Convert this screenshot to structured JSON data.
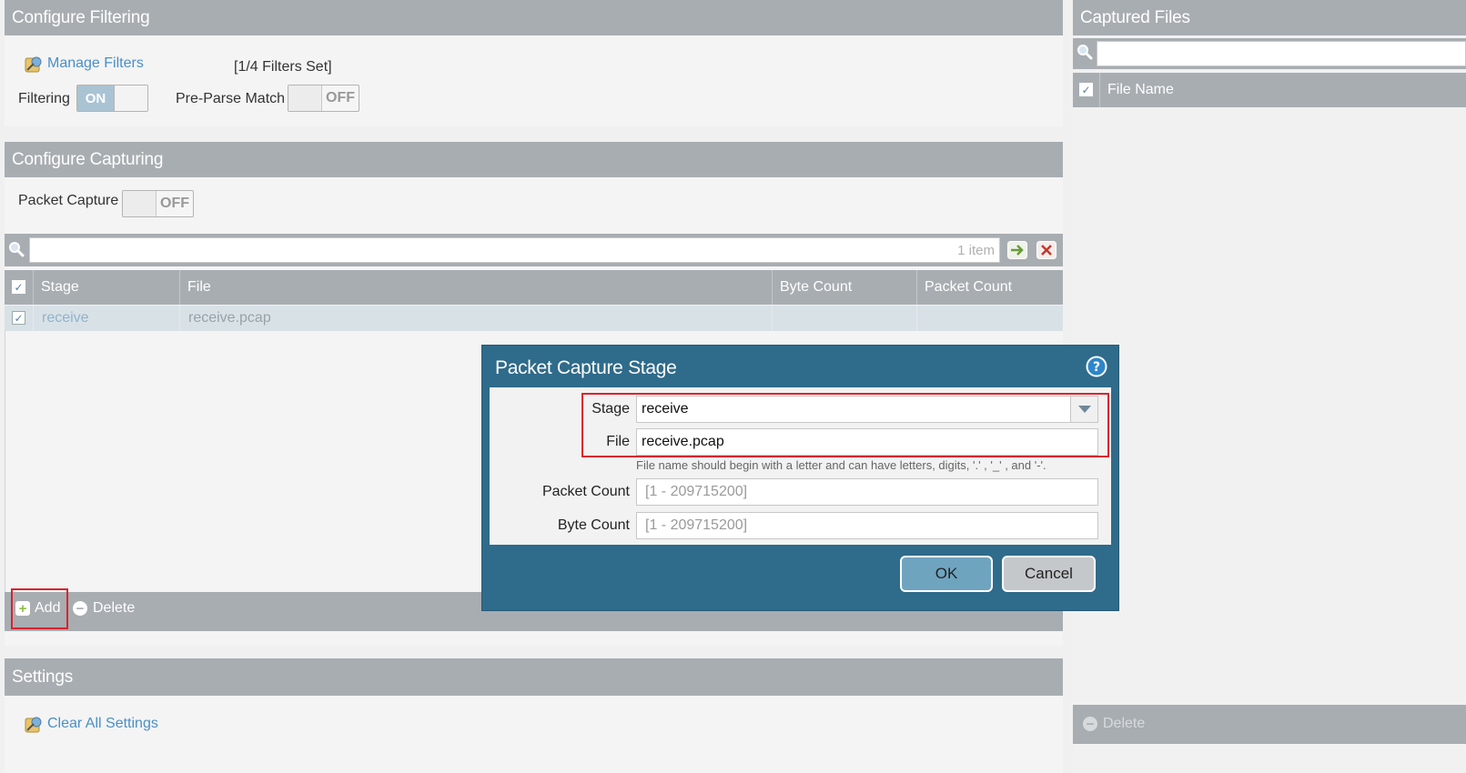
{
  "filtering": {
    "header": "Configure Filtering",
    "manage_filters": "Manage Filters",
    "filters_set": "[1/4 Filters Set]",
    "filtering_label": "Filtering",
    "filtering_state": "ON",
    "preparse_label": "Pre-Parse Match",
    "preparse_state": "OFF"
  },
  "capturing": {
    "header": "Configure Capturing",
    "packet_capture_label": "Packet Capture",
    "packet_capture_state": "OFF",
    "item_count": "1 item",
    "columns": [
      "Stage",
      "File",
      "Byte Count",
      "Packet Count"
    ],
    "rows": [
      {
        "stage": "receive",
        "file": "receive.pcap",
        "byte_count": "",
        "packet_count": ""
      }
    ],
    "add_label": "Add",
    "delete_label": "Delete"
  },
  "settings": {
    "header": "Settings",
    "clear_all": "Clear All Settings"
  },
  "captured_files": {
    "header": "Captured Files",
    "column": "File Name",
    "delete_label": "Delete"
  },
  "dialog": {
    "title": "Packet Capture Stage",
    "stage_label": "Stage",
    "stage_value": "receive",
    "file_label": "File",
    "file_value": "receive.pcap",
    "hint": "File name should begin with a letter and can have letters, digits, '.' , '_' , and '-'.",
    "packet_count_label": "Packet Count",
    "packet_count_placeholder": "[1 - 209715200]",
    "byte_count_label": "Byte Count",
    "byte_count_placeholder": "[1 - 209715200]",
    "ok_label": "OK",
    "cancel_label": "Cancel"
  },
  "colors": {
    "header_gray": "#a8adb2",
    "dialog_blue": "#2f6b8a",
    "link_blue": "#4a8fc6",
    "highlight_red": "#d9232d"
  }
}
